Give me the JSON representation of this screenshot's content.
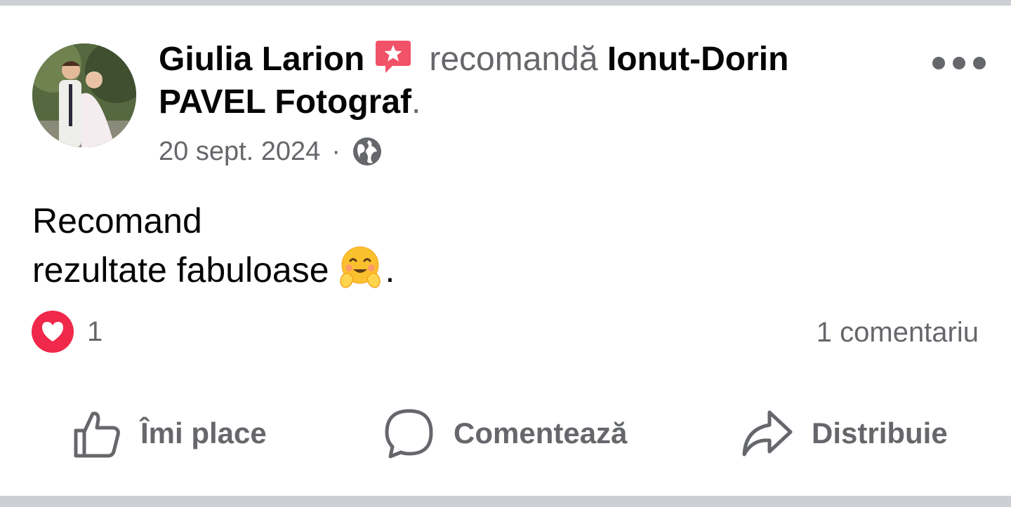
{
  "post": {
    "author": "Giulia Larion",
    "verb": "recomandă",
    "page_line1": "Ionut-Dorin",
    "page_line2": "PAVEL Fotograf",
    "period": ".",
    "date": "20 sept. 2024",
    "separator": "·",
    "privacy_icon": "globe-icon",
    "badge_icon": "recommend-badge-icon",
    "text_line1": "Recomand",
    "text_line2": "rezultate fabuloase",
    "text_emoji": "hugging-face-emoji",
    "text_end": "."
  },
  "stats": {
    "reaction_icon": "love-reaction-icon",
    "reaction_count": "1",
    "comments": "1 comentariu"
  },
  "actions": {
    "like": "Îmi place",
    "comment": "Comentează",
    "share": "Distribuie"
  },
  "colors": {
    "secondary_text": "#65676b",
    "primary_text": "#050505",
    "love": "#f0284a",
    "badge": "#f25268",
    "divider": "#ccd0d5"
  }
}
